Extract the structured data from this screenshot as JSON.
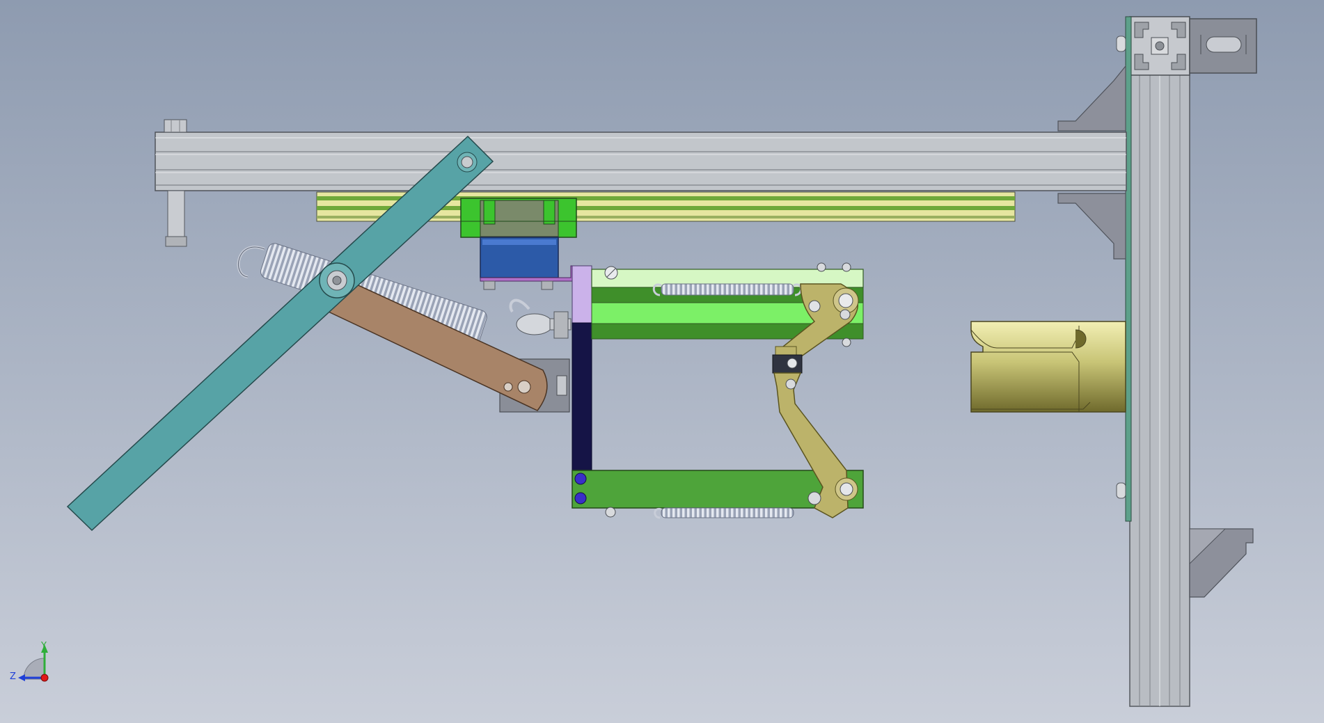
{
  "viewport": {
    "background_top": "#8e9bb0",
    "background_bottom": "#c9ced9"
  },
  "triad": {
    "y_label": "Y",
    "z_label": "Z",
    "y_color": "#2fae3a",
    "z_color": "#1f3fd8",
    "x_color": "#e01818"
  },
  "colors": {
    "aluminum": "#b9bdc3",
    "aluminum_dark": "#8d9197",
    "teal_link": "#57a3a6",
    "bronze_link": "#a88468",
    "spring": "#b0b8c8",
    "rail_yellow": "#e6e6a0",
    "rail_green": "#6fa83a",
    "carriage_green": "#3cc42e",
    "motor_blue": "#2c5aa8",
    "purple_plate": "#b070c8",
    "lavender": "#cbb2ea",
    "navy": "#151446",
    "box_top": "#d6f7c4",
    "box_mid_dark": "#3f8f2a",
    "box_mid_light": "#7cf067",
    "box_bottom": "#4ea43a",
    "olive_link": "#bcb36a",
    "gripper": "#c8c476",
    "bracket_gray": "#7f838f",
    "hole_blue": "#3a2fc8"
  }
}
